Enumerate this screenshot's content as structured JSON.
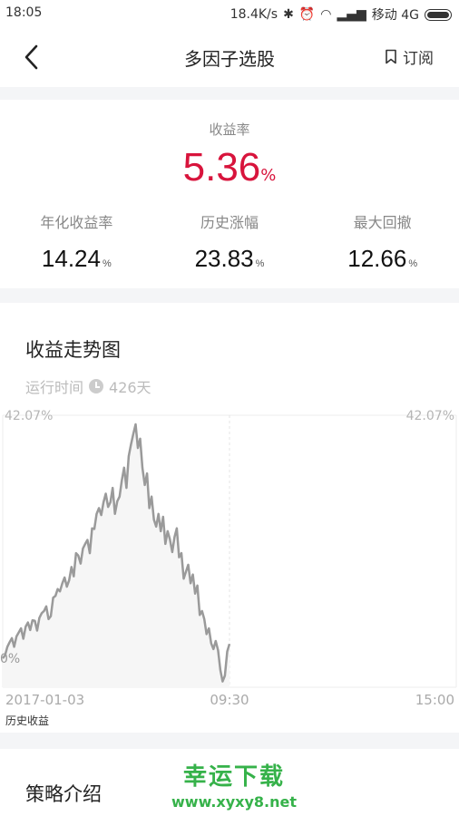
{
  "status_bar": {
    "time": "18:05",
    "network_speed": "18.4K/s",
    "carrier": "移动 4G"
  },
  "header": {
    "title": "多因子选股",
    "subscribe_label": "订阅"
  },
  "summary": {
    "yield_label": "收益率",
    "yield_value": "5.36",
    "yield_unit": "%",
    "accent_color": "#d8143c",
    "stats": [
      {
        "label": "年化收益率",
        "value": "14.24",
        "unit": "%"
      },
      {
        "label": "历史涨幅",
        "value": "23.83",
        "unit": "%"
      },
      {
        "label": "最大回撤",
        "value": "12.66",
        "unit": "%"
      }
    ]
  },
  "trend": {
    "title": "收益走势图",
    "runtime_label": "运行时间",
    "runtime_value": "426天",
    "series_label": "历史收益"
  },
  "chart_data": {
    "type": "line",
    "y_max_label_left": "42.07%",
    "y_max_label_right": "42.07%",
    "y_zero_label": "0%",
    "x_tick_labels": [
      "2017-01-03",
      "09:30",
      "15:00"
    ],
    "ylim": [
      -5,
      42.07
    ],
    "x": [
      0,
      1,
      2,
      3,
      4,
      5,
      6,
      7,
      8,
      9,
      10,
      11,
      12,
      13,
      14,
      15,
      16,
      17,
      18,
      19,
      20,
      21,
      22,
      23,
      24,
      25,
      26,
      27,
      28,
      29,
      30,
      31,
      32,
      33,
      34,
      35,
      36,
      37,
      38,
      39,
      40,
      41,
      42,
      43,
      44,
      45,
      46,
      47,
      48,
      49,
      50,
      51,
      52,
      53,
      54,
      55,
      56,
      57,
      58,
      59,
      60,
      61,
      62,
      63,
      64,
      65,
      66,
      67,
      68,
      69,
      70,
      71,
      72,
      73,
      74,
      75,
      76,
      77,
      78,
      79,
      80,
      81,
      82,
      83,
      84,
      85,
      86,
      87,
      88,
      89,
      90,
      91,
      92,
      93,
      94,
      95,
      96,
      97,
      98,
      99
    ],
    "values": [
      0,
      0.5,
      2,
      2.8,
      3.5,
      2,
      3.8,
      4.5,
      5.2,
      3.4,
      5.5,
      6.2,
      4.9,
      6.6,
      6.5,
      4.8,
      7,
      7.8,
      8.2,
      9,
      6.8,
      7.3,
      10.5,
      10.8,
      12,
      11.6,
      13,
      14,
      12.4,
      13.5,
      15.8,
      14.2,
      18.2,
      17.8,
      16.4,
      19,
      19.8,
      20.5,
      18.2,
      22.5,
      22.4,
      25,
      26,
      24.8,
      27,
      28.5,
      26.2,
      27,
      29.5,
      25,
      27.2,
      28,
      30.8,
      33,
      29.5,
      35,
      37,
      38.8,
      40.5,
      36.4,
      38,
      33,
      30,
      32,
      26,
      28,
      24,
      22.8,
      25,
      22,
      24.5,
      19.8,
      22,
      20.6,
      18.4,
      21,
      22.5,
      17.5,
      18.2,
      13.8,
      15,
      16.2,
      13,
      14.5,
      11.2,
      12.6,
      7.5,
      8.2,
      6.8,
      4.2,
      5.2,
      2.6,
      1.6,
      3,
      1.4,
      -2,
      -4,
      -3,
      1.2,
      2.5
    ],
    "grid": true
  }
}
